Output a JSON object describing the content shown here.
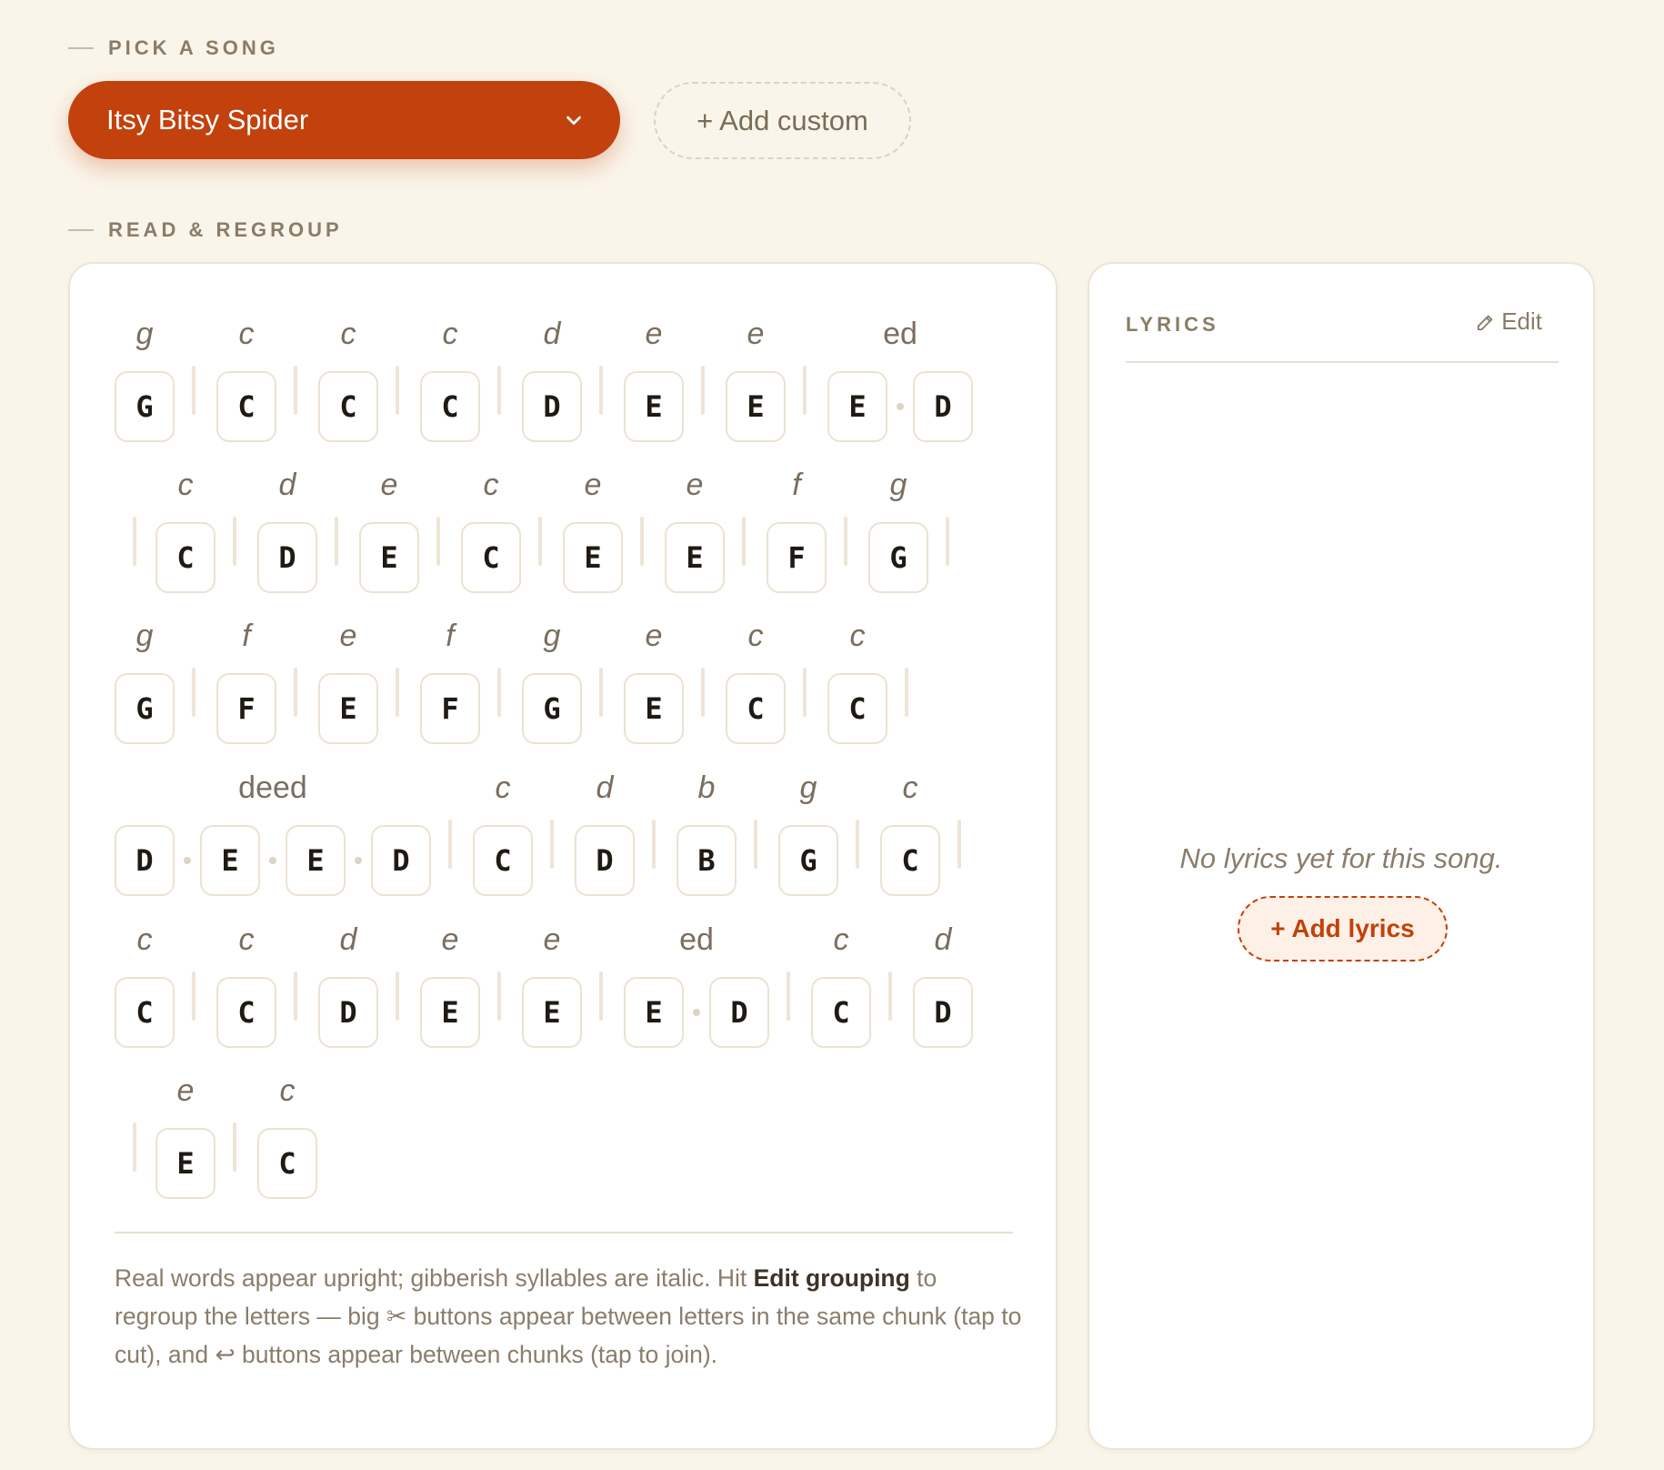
{
  "sections": {
    "pick_label": "PICK A SONG",
    "read_label": "READ & REGROUP"
  },
  "song_select": {
    "value": "Itsy Bitsy Spider"
  },
  "add_custom_label": "+ Add custom",
  "grouping": {
    "rows": [
      [
        {
          "syllable": "g",
          "italic": true,
          "letters": [
            "G"
          ]
        },
        {
          "syllable": "c",
          "italic": true,
          "letters": [
            "C"
          ]
        },
        {
          "syllable": "c",
          "italic": true,
          "letters": [
            "C"
          ]
        },
        {
          "syllable": "c",
          "italic": true,
          "letters": [
            "C"
          ]
        },
        {
          "syllable": "d",
          "italic": true,
          "letters": [
            "D"
          ]
        },
        {
          "syllable": "e",
          "italic": true,
          "letters": [
            "E"
          ]
        },
        {
          "syllable": "e",
          "italic": true,
          "letters": [
            "E"
          ]
        },
        {
          "syllable": "ed",
          "italic": false,
          "letters": [
            "E",
            "D"
          ]
        }
      ],
      [
        {
          "syllable": "c",
          "italic": true,
          "letters": [
            "C"
          ]
        },
        {
          "syllable": "d",
          "italic": true,
          "letters": [
            "D"
          ]
        },
        {
          "syllable": "e",
          "italic": true,
          "letters": [
            "E"
          ]
        },
        {
          "syllable": "c",
          "italic": true,
          "letters": [
            "C"
          ]
        },
        {
          "syllable": "e",
          "italic": true,
          "letters": [
            "E"
          ]
        },
        {
          "syllable": "e",
          "italic": true,
          "letters": [
            "E"
          ]
        },
        {
          "syllable": "f",
          "italic": true,
          "letters": [
            "F"
          ]
        },
        {
          "syllable": "g",
          "italic": true,
          "letters": [
            "G"
          ]
        }
      ],
      [
        {
          "syllable": "g",
          "italic": true,
          "letters": [
            "G"
          ]
        },
        {
          "syllable": "f",
          "italic": true,
          "letters": [
            "F"
          ]
        },
        {
          "syllable": "e",
          "italic": true,
          "letters": [
            "E"
          ]
        },
        {
          "syllable": "f",
          "italic": true,
          "letters": [
            "F"
          ]
        },
        {
          "syllable": "g",
          "italic": true,
          "letters": [
            "G"
          ]
        },
        {
          "syllable": "e",
          "italic": true,
          "letters": [
            "E"
          ]
        },
        {
          "syllable": "c",
          "italic": true,
          "letters": [
            "C"
          ]
        },
        {
          "syllable": "c",
          "italic": true,
          "letters": [
            "C"
          ]
        }
      ],
      [
        {
          "syllable": "deed",
          "italic": false,
          "letters": [
            "D",
            "E",
            "E",
            "D"
          ]
        },
        {
          "syllable": "c",
          "italic": true,
          "letters": [
            "C"
          ]
        },
        {
          "syllable": "d",
          "italic": true,
          "letters": [
            "D"
          ]
        },
        {
          "syllable": "b",
          "italic": true,
          "letters": [
            "B"
          ]
        },
        {
          "syllable": "g",
          "italic": true,
          "letters": [
            "G"
          ]
        },
        {
          "syllable": "c",
          "italic": true,
          "letters": [
            "C"
          ]
        }
      ],
      [
        {
          "syllable": "c",
          "italic": true,
          "letters": [
            "C"
          ]
        },
        {
          "syllable": "c",
          "italic": true,
          "letters": [
            "C"
          ]
        },
        {
          "syllable": "d",
          "italic": true,
          "letters": [
            "D"
          ]
        },
        {
          "syllable": "e",
          "italic": true,
          "letters": [
            "E"
          ]
        },
        {
          "syllable": "e",
          "italic": true,
          "letters": [
            "E"
          ]
        },
        {
          "syllable": "ed",
          "italic": false,
          "letters": [
            "E",
            "D"
          ]
        },
        {
          "syllable": "c",
          "italic": true,
          "letters": [
            "C"
          ]
        },
        {
          "syllable": "d",
          "italic": true,
          "letters": [
            "D"
          ]
        }
      ],
      [
        {
          "syllable": "e",
          "italic": true,
          "letters": [
            "E"
          ]
        },
        {
          "syllable": "c",
          "italic": true,
          "letters": [
            "C"
          ]
        }
      ]
    ],
    "help": {
      "part1": "Real words appear upright; gibberish syllables are italic. Hit ",
      "bold": "Edit grouping",
      "part2": " to regroup the letters — big ✂ buttons appear between letters in the same chunk (tap to cut), and ↩ buttons appear between chunks (tap to join)."
    }
  },
  "lyrics": {
    "title": "LYRICS",
    "edit_label": "Edit",
    "edit_icon": "pencil-icon",
    "empty_text": "No lyrics yet for this song.",
    "add_label": "+ Add lyrics"
  },
  "colors": {
    "accent": "#c2410c",
    "background": "#faf5ea",
    "card": "#ffffff"
  }
}
